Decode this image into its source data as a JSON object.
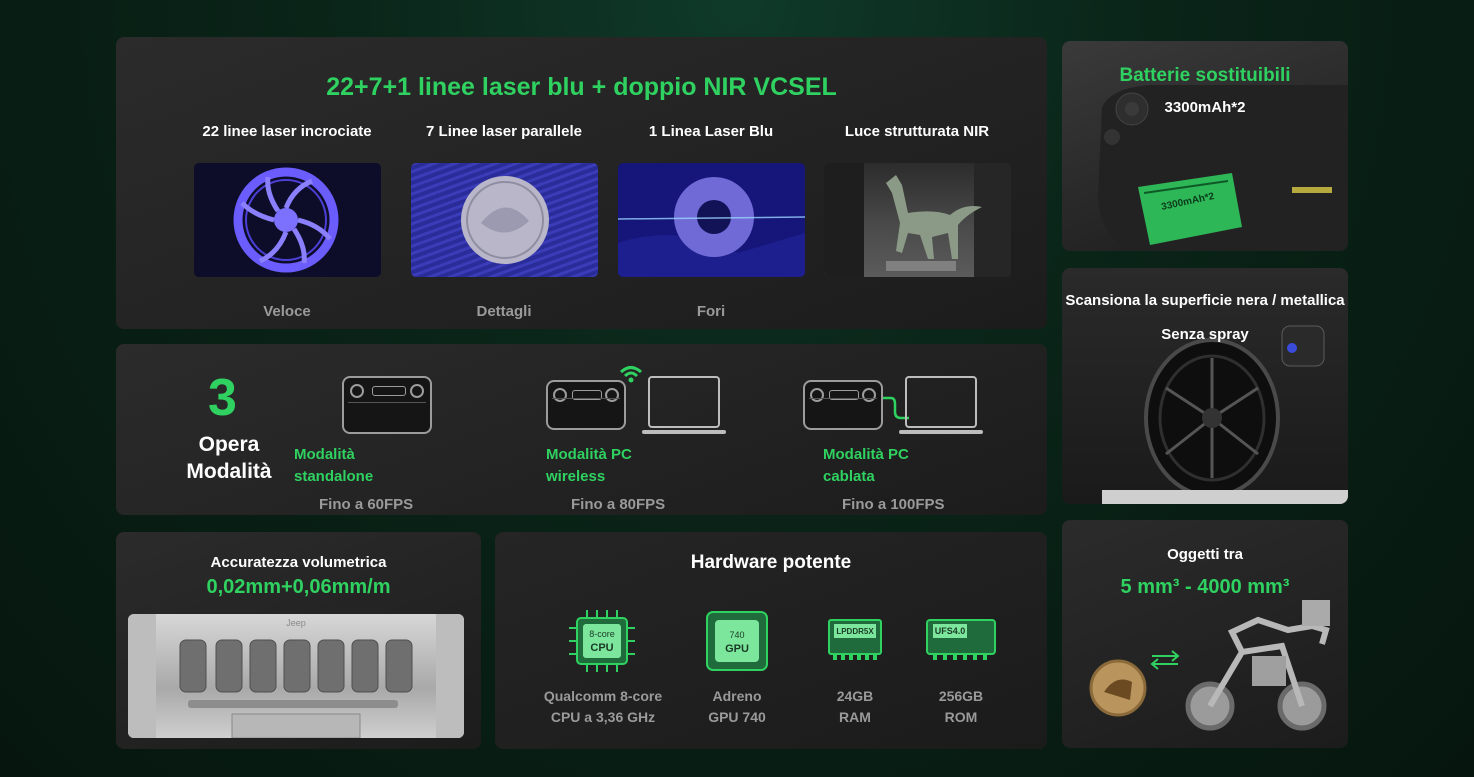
{
  "laser": {
    "title": "22+7+1 linee laser blu + doppio NIR VCSEL",
    "columns": [
      {
        "label": "22 linee laser incrociate",
        "caption": "Veloce"
      },
      {
        "label": "7 Linee laser parallele",
        "caption": "Dettagli"
      },
      {
        "label": "1 Linea Laser Blu",
        "caption": "Fori"
      },
      {
        "label": "Luce strutturata NIR",
        "caption": ""
      }
    ]
  },
  "modes": {
    "count": "3",
    "title_line1": "Opera",
    "title_line2": "Modalità",
    "items": [
      {
        "name_line1": "Modalità",
        "name_line2": "standalone",
        "fps": "Fino a 60FPS"
      },
      {
        "name_line1": "Modalità PC",
        "name_line2": "wireless",
        "fps": "Fino a 80FPS"
      },
      {
        "name_line1": "Modalità PC",
        "name_line2": "cablata",
        "fps": "Fino a 100FPS"
      }
    ]
  },
  "accuracy": {
    "title": "Accuratezza volumetrica",
    "value": "0,02mm+0,06mm/m",
    "grille_text": "Jeep"
  },
  "hardware": {
    "title": "Hardware potente",
    "chips": [
      {
        "chip_line1": "8-core",
        "chip_line2": "CPU",
        "cap_line1": "Qualcomm 8-core",
        "cap_line2": "CPU a 3,36 GHz"
      },
      {
        "chip_line1": "740",
        "chip_line2": "GPU",
        "cap_line1": "Adreno",
        "cap_line2": "GPU 740"
      },
      {
        "chip_line1": "LPDDR5X",
        "chip_line2": "",
        "cap_line1": "24GB",
        "cap_line2": "RAM"
      },
      {
        "chip_line1": "UFS4.0",
        "chip_line2": "",
        "cap_line1": "256GB",
        "cap_line2": "ROM"
      }
    ]
  },
  "battery": {
    "title": "Batterie sostituibili",
    "subtitle": "3300mAh*2",
    "pack_label": "3300mAh*2"
  },
  "scan": {
    "title": "Scansiona la superficie nera / metallica",
    "subtitle": "Senza spray"
  },
  "objects": {
    "title": "Oggetti tra",
    "range": "5 mm³ - 4000 mm³"
  },
  "colors": {
    "accent": "#2fd160",
    "card": "#232323",
    "muted": "#9a9a9a"
  }
}
